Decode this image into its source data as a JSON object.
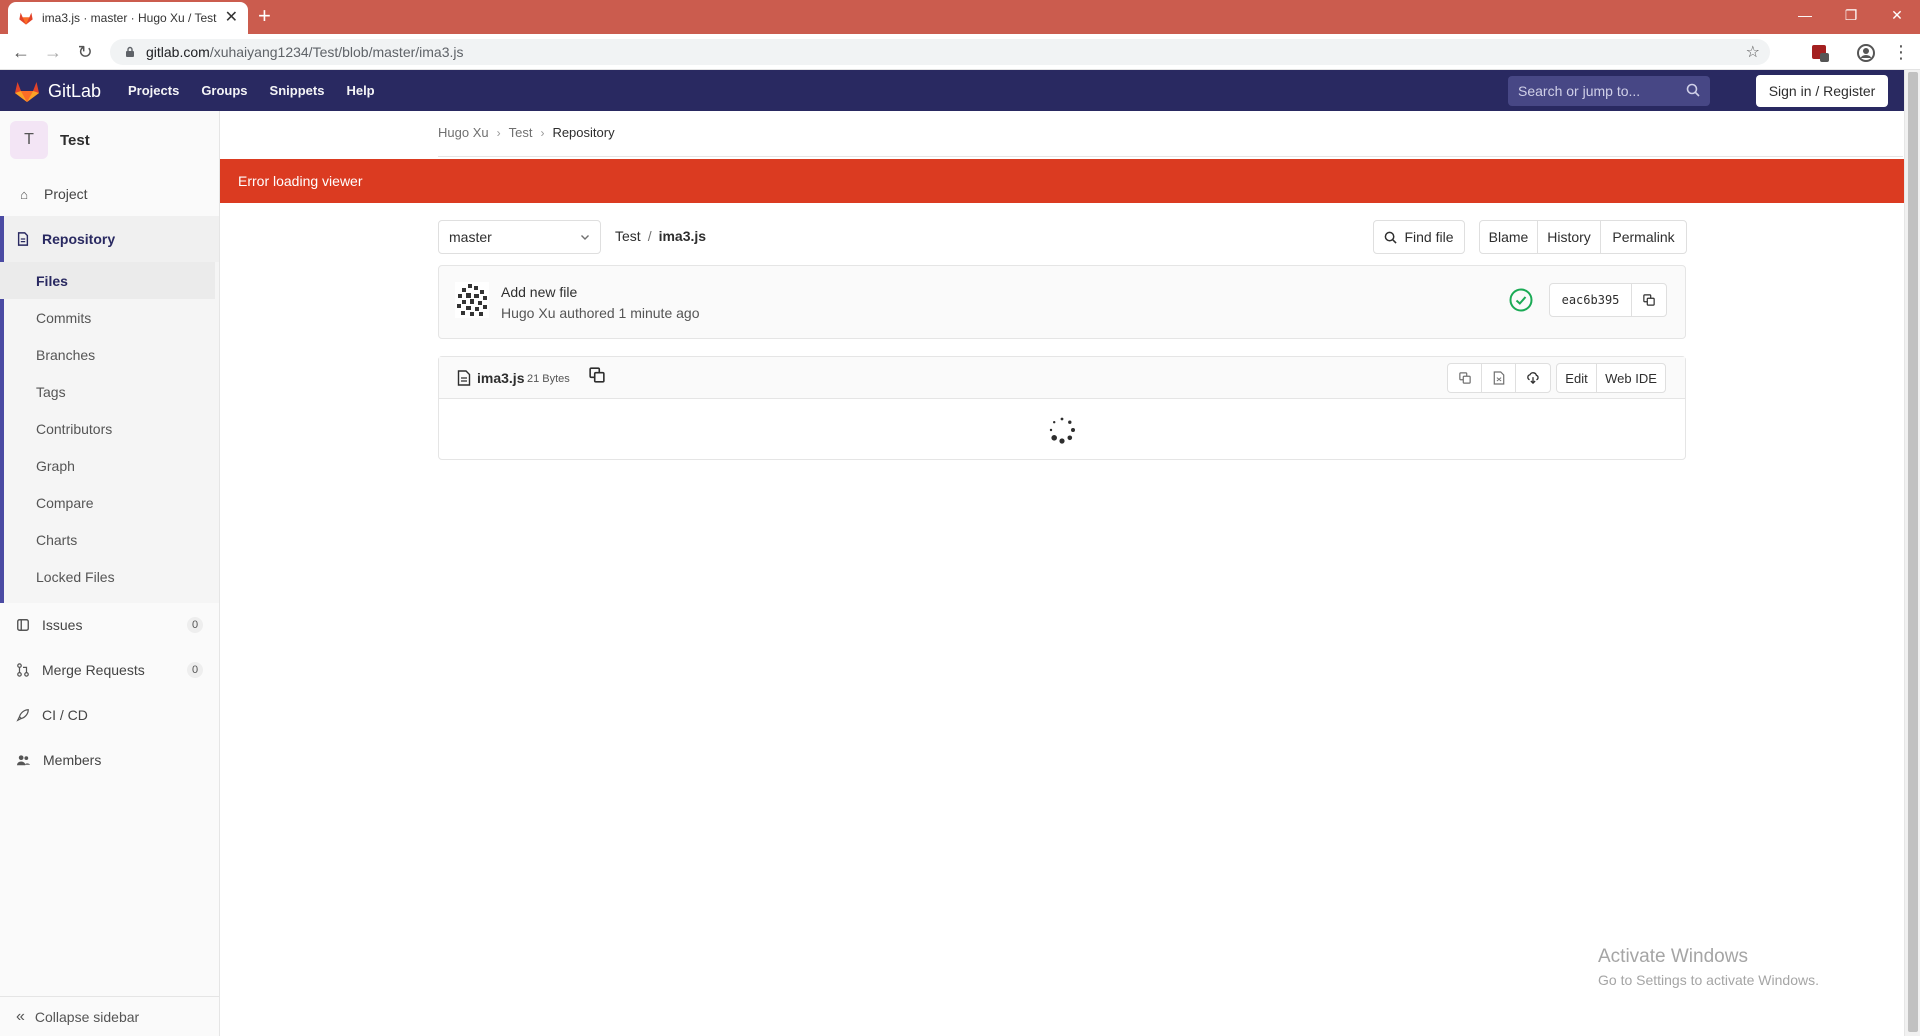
{
  "browser": {
    "tab_title": "ima3.js · master · Hugo Xu / Test",
    "url_host": "gitlab.com",
    "url_path": "/xuhaiyang1234/Test/blob/master/ima3.js"
  },
  "navbar": {
    "brand": "GitLab",
    "menu": [
      "Projects",
      "Groups",
      "Snippets",
      "Help"
    ],
    "search_placeholder": "Search or jump to...",
    "signin": "Sign in / Register"
  },
  "sidebar": {
    "avatar_letter": "T",
    "project_name": "Test",
    "items": {
      "project": "Project",
      "repository": "Repository",
      "issues": "Issues",
      "issues_count": "0",
      "merge_requests": "Merge Requests",
      "merge_requests_count": "0",
      "cicd": "CI / CD",
      "members": "Members"
    },
    "repo_sub": [
      "Files",
      "Commits",
      "Branches",
      "Tags",
      "Contributors",
      "Graph",
      "Compare",
      "Charts",
      "Locked Files"
    ],
    "collapse": "Collapse sidebar"
  },
  "breadcrumbs": [
    "Hugo Xu",
    "Test",
    "Repository"
  ],
  "flash_error": "Error loading viewer",
  "tree": {
    "branch": "master",
    "path_root": "Test",
    "path_sep": "/",
    "file": "ima3.js",
    "find_file": "Find file",
    "blame": "Blame",
    "history": "History",
    "permalink": "Permalink"
  },
  "commit": {
    "title": "Add new file",
    "author": "Hugo Xu",
    "meta_suffix": "authored 1 minute ago",
    "sha": "eac6b395",
    "status_color": "#1aaa55"
  },
  "file": {
    "name": "ima3.js",
    "size": "21 Bytes",
    "edit": "Edit",
    "web_ide": "Web IDE"
  },
  "watermark": {
    "line1": "Activate Windows",
    "line2": "Go to Settings to activate Windows."
  },
  "colors": {
    "tabbar": "#cb5c4e",
    "navbar": "#292961",
    "flash": "#db3b21",
    "accent": "#4b4ba3"
  }
}
